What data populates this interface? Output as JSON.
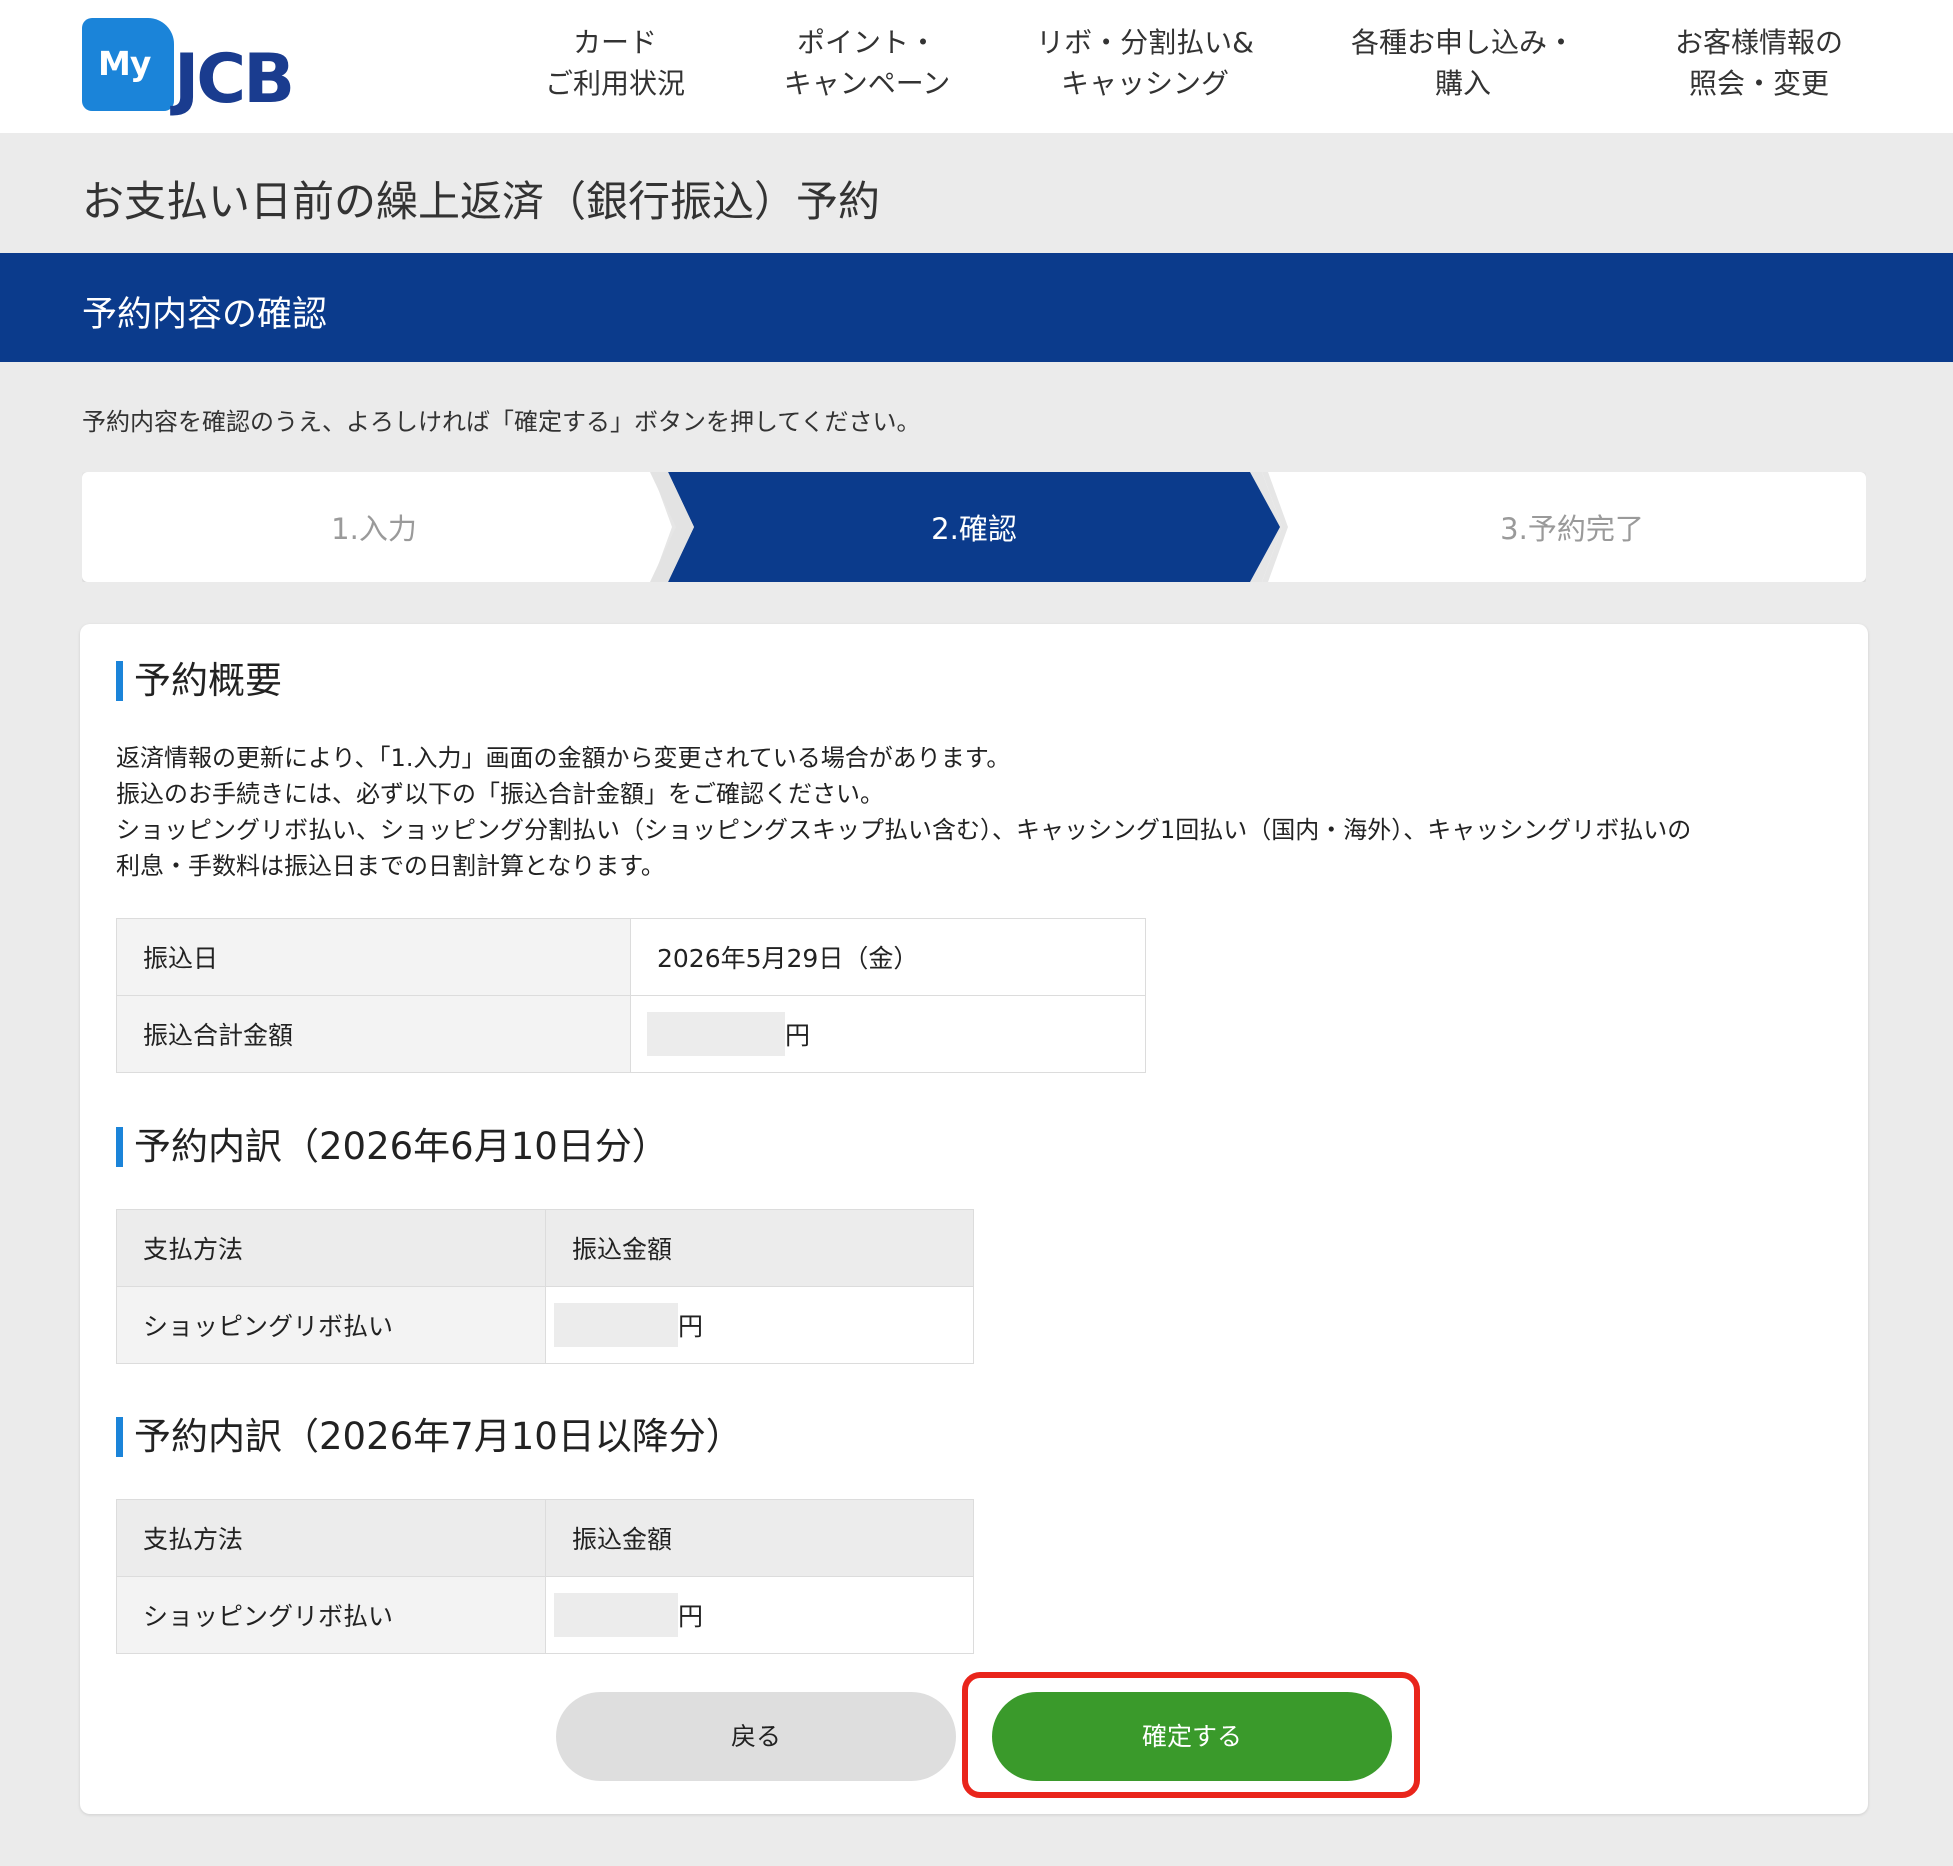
{
  "brand": {
    "my": "My",
    "jcb": "JCB"
  },
  "nav": {
    "items": [
      {
        "line1": "カード",
        "line2": "ご利用状況"
      },
      {
        "line1": "ポイント・",
        "line2": "キャンペーン"
      },
      {
        "line1": "リボ・分割払い&",
        "line2": "キャッシング"
      },
      {
        "line1": "各種お申し込み・",
        "line2": "購入"
      },
      {
        "line1": "お客様情報の",
        "line2": "照会・変更"
      }
    ]
  },
  "page_title": "お支払い日前の繰上返済（銀行振込）予約",
  "section_title": "予約内容の確認",
  "instruction": "予約内容を確認のうえ、よろしければ「確定する」ボタンを押してください。",
  "stepper": {
    "steps": [
      "1.入力",
      "2.確認",
      "3.予約完了"
    ],
    "active_index": 1,
    "active_color": "#0b3b8c"
  },
  "summary": {
    "heading": "予約概要",
    "notes": [
      "返済情報の更新により、「1.入力」画面の金額から変更されている場合があります。",
      "振込のお手続きには、必ず以下の「振込合計金額」をご確認ください。",
      "ショッピングリボ払い、ショッピング分割払い（ショッピングスキップ払い含む）、キャッシング1回払い（国内・海外）、キャッシングリボ払いの",
      "利息・手数料は振込日までの日割計算となります。"
    ],
    "rows": [
      {
        "label": "振込日",
        "value": "2026年5月29日（金）"
      },
      {
        "label": "振込合計金額",
        "unit": "円"
      }
    ]
  },
  "breakdown1": {
    "heading": "予約内訳（2026年6月10日分）",
    "col1": "支払方法",
    "col2": "振込金額",
    "method": "ショッピングリボ払い",
    "unit": "円"
  },
  "breakdown2": {
    "heading": "予約内訳（2026年7月10日以降分）",
    "col1": "支払方法",
    "col2": "振込金額",
    "method": "ショッピングリボ払い",
    "unit": "円"
  },
  "buttons": {
    "back": "戻る",
    "confirm": "確定する"
  },
  "colors": {
    "brand_blue": "#0b3b8c",
    "accent_blue": "#1b84d9",
    "confirm_green": "#3a9a2b",
    "highlight_red": "#e9251b"
  }
}
